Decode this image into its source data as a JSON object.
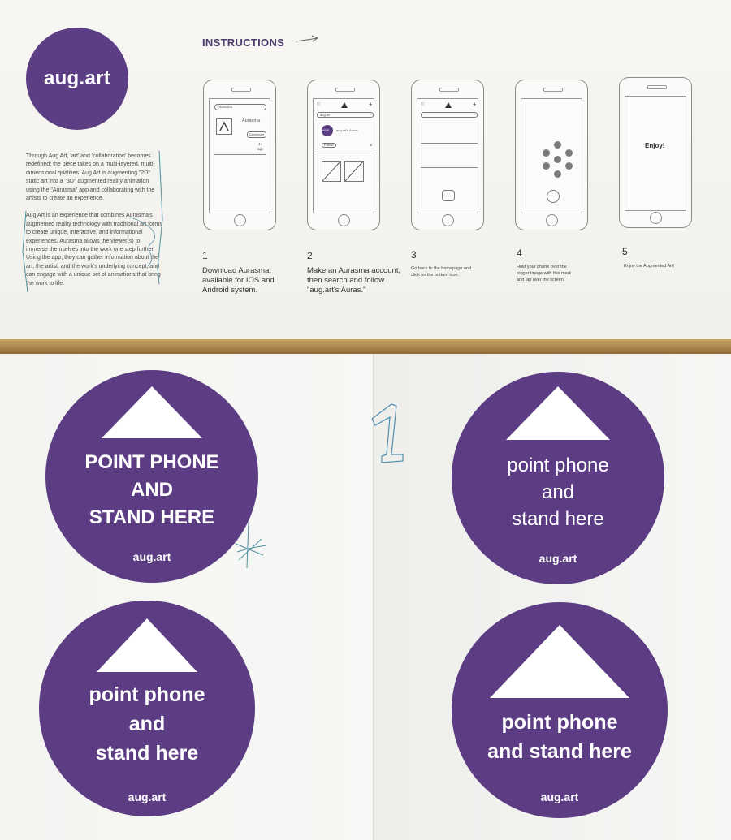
{
  "logo": {
    "text": "aug.art"
  },
  "intro": {
    "p1": "Through Aug Art, 'art' and 'collaboration' becomes redefined; the piece takes on a multi-layered, multi-dimensional qualities. Aug Art is augmenting \"2D\" static art into a \"3D\" augmented reality animation using the \"Aurasma\" app and collaborating with the artists to create an experience.",
    "p2": "Aug Art is an experience that combines Aurasma's augmented reality technology with traditional art forms to create unique, interactive, and informational experiences. Aurasma allows the viewer(s) to immerse themselves into the work one step further: Using the app, they can gather information about the art, the artist, and the work's underlying concept, and can engage with a unique set of animations that bring the work to life."
  },
  "instructions": {
    "title": "INSTRUCTIONS",
    "phone1": {
      "search": "Aurasma",
      "app_name": "Aurasma",
      "button": "Download",
      "rating": "4+",
      "rating_label": "age"
    },
    "phone2": {
      "search": "aug.art",
      "avatar": "aug.art",
      "account": "aug.art's Auras",
      "button": "Follow",
      "count": "8"
    },
    "phone5": {
      "screen_text": "Enjoy!"
    },
    "steps": [
      {
        "num": "1",
        "text": "Download Aurasma, available for IOS and Android system."
      },
      {
        "num": "2",
        "text": "Make an Aurasma account, then search and follow \"aug.art's Auras.\""
      },
      {
        "num": "3",
        "text": "Go back to the homepage and click on the bottom icon."
      },
      {
        "num": "4",
        "text": "Hold your phone over the trigger image with this mark and tap over the screen."
      },
      {
        "num": "5",
        "text": "Enjoy the Augmented Art!"
      }
    ]
  },
  "stickers": [
    {
      "line1": "POINT PHONE",
      "line2": "AND",
      "line3": "STAND HERE",
      "brand": "aug.art"
    },
    {
      "line1": "point phone",
      "line2": "and",
      "line3": "stand here",
      "brand": "aug.art"
    },
    {
      "line1": "point phone",
      "line2": "and",
      "line3": "stand here",
      "brand": "aug.art"
    },
    {
      "line1": "point phone",
      "line2": "and stand here",
      "brand": "aug.art"
    }
  ],
  "handwriting": {
    "digit": "1"
  },
  "colors": {
    "purple": "#5c3d84",
    "desk": "#a8834b",
    "paper": "#f5f5f3"
  }
}
